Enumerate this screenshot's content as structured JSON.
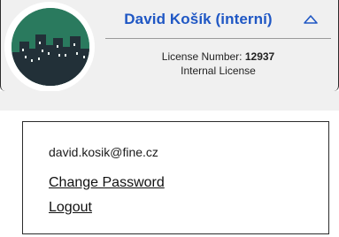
{
  "user": {
    "name": "David Košík (interní)",
    "email": "david.kosik@fine.cz"
  },
  "license": {
    "number_label": "License Number:",
    "number_value": "12937",
    "type": "Internal License"
  },
  "icons": {
    "avatar": "city-skyline-avatar-icon",
    "toggle": "chevron-up-icon"
  },
  "menu": {
    "change_password": "Change Password",
    "logout": "Logout"
  },
  "colors": {
    "name_accent": "#1f57c4",
    "avatar_bg": "#2a7a5e",
    "avatar_buildings": "#223038"
  }
}
